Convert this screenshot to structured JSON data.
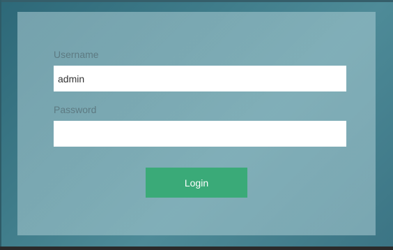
{
  "login_form": {
    "username_label": "Username",
    "username_value": "admin",
    "password_label": "Password",
    "password_value": "",
    "login_button_label": "Login"
  },
  "colors": {
    "background": "#3f7c8a",
    "panel": "#a6c8d0",
    "login_button": "#3aaa78",
    "label_text": "#5d7a82"
  }
}
